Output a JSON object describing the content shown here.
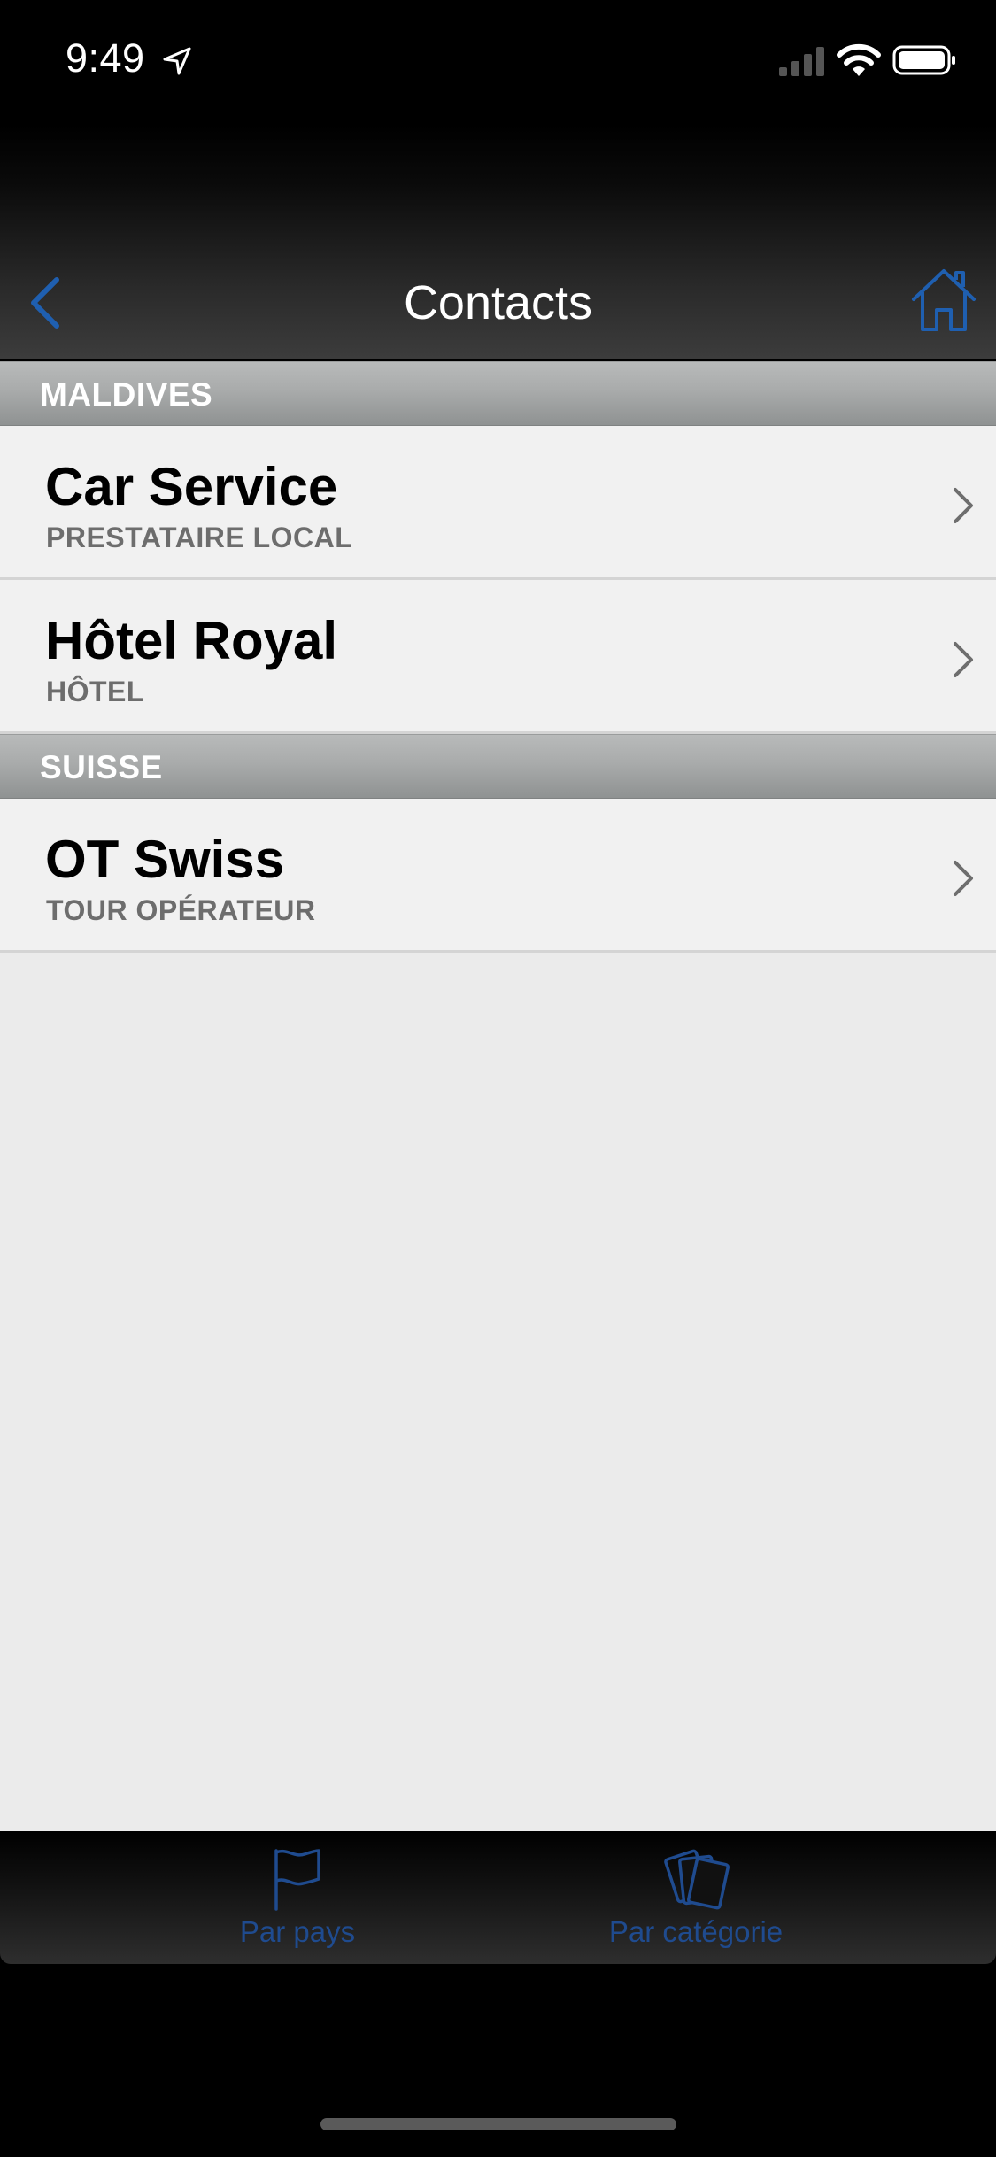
{
  "status_bar": {
    "time": "9:49",
    "location_icon": "location-arrow-icon",
    "signal_icon": "cellular-signal-icon",
    "wifi_icon": "wifi-icon",
    "battery_icon": "battery-icon"
  },
  "nav": {
    "title": "Contacts",
    "back_icon": "chevron-left-icon",
    "home_icon": "home-icon",
    "accent_color": "#1f5fb0"
  },
  "sections": [
    {
      "header": "MALDIVES",
      "rows": [
        {
          "title": "Car Service",
          "subtitle": "PRESTATAIRE LOCAL"
        },
        {
          "title": "Hôtel Royal",
          "subtitle": "HÔTEL"
        }
      ]
    },
    {
      "header": "SUISSE",
      "rows": [
        {
          "title": "OT Swiss",
          "subtitle": "TOUR OPÉRATEUR"
        }
      ]
    }
  ],
  "tab_bar": {
    "tabs": [
      {
        "label": "Par pays",
        "icon": "flag-icon"
      },
      {
        "label": "Par catégorie",
        "icon": "cards-icon"
      }
    ],
    "tab_color": "#1f4b8f"
  }
}
